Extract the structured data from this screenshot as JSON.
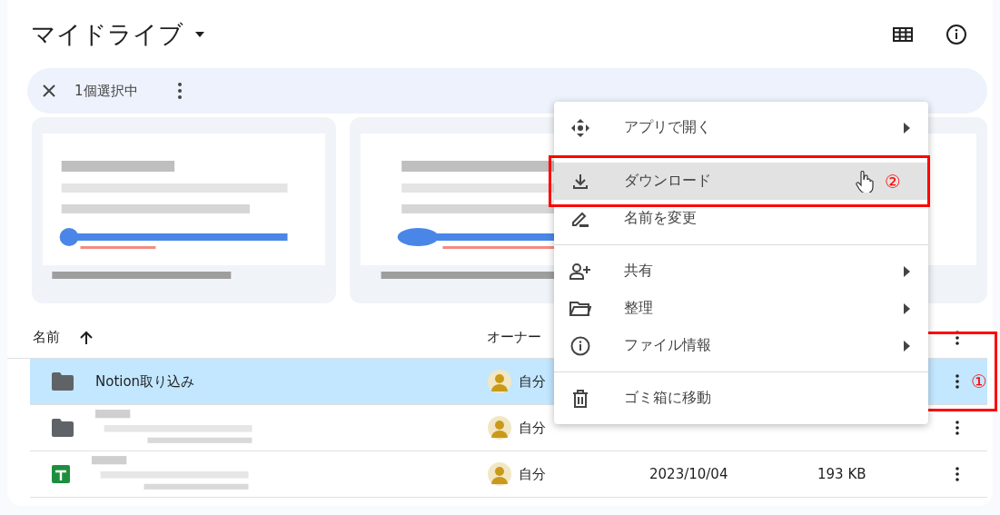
{
  "title": "マイドライブ",
  "selection_bar": {
    "count_text": "1個選択中"
  },
  "table": {
    "columns": [
      "名前",
      "オーナー"
    ],
    "rows": [
      {
        "kind": "folder",
        "name": "Notion取り込み",
        "owner": "自分",
        "selected": true,
        "annotation": "①"
      },
      {
        "kind": "folder",
        "owner": "自分",
        "selected": false
      },
      {
        "kind": "sheet",
        "owner": "自分",
        "date": "2023/10/04",
        "size": "193 KB",
        "selected": false
      }
    ]
  },
  "context_menu": {
    "groups": [
      [
        {
          "kind": "move",
          "label": "アプリで開く",
          "submenu": true,
          "highlighted": false
        },
        {
          "kind": "download",
          "label": "ダウンロード",
          "submenu": false,
          "highlighted": true,
          "annotation": "②"
        },
        {
          "kind": "rename",
          "label": "名前を変更",
          "submenu": false,
          "highlighted": false
        }
      ],
      [
        {
          "kind": "share",
          "label": "共有",
          "submenu": true,
          "highlighted": false
        },
        {
          "kind": "folder",
          "label": "整理",
          "submenu": true,
          "highlighted": false
        },
        {
          "kind": "info",
          "label": "ファイル情報",
          "submenu": true,
          "highlighted": false
        }
      ],
      [
        {
          "kind": "trash",
          "label": "ゴミ箱に移動",
          "submenu": false,
          "highlighted": false
        }
      ]
    ]
  }
}
